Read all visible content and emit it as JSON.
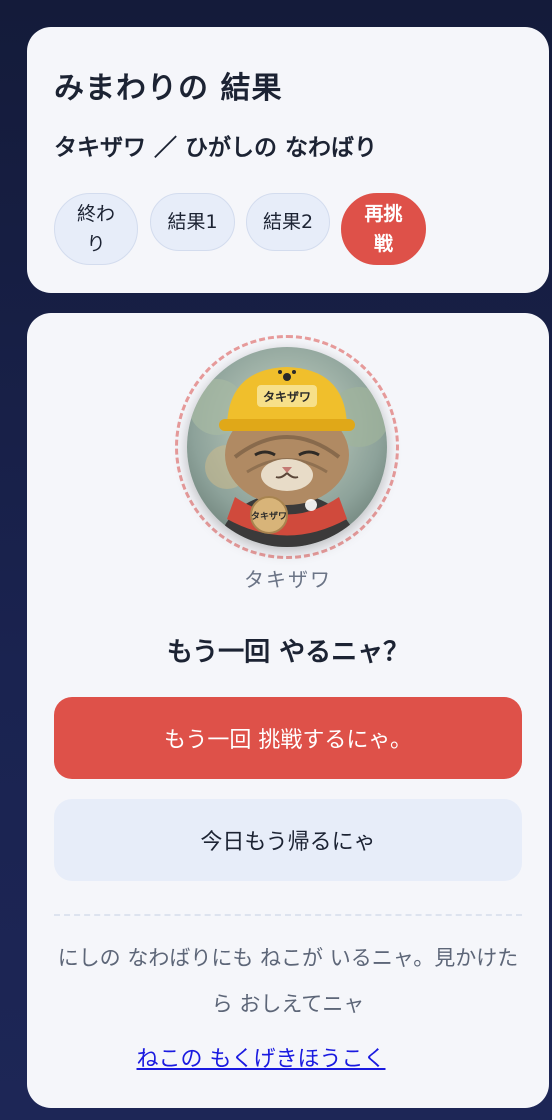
{
  "header": {
    "title": "みまわりの 結果",
    "subtitle": "タキザワ ／ ひがしの なわばり"
  },
  "tabs": [
    {
      "label": "終わり"
    },
    {
      "label": "結果1"
    },
    {
      "label": "結果2"
    },
    {
      "label": "再挑戦"
    }
  ],
  "avatar": {
    "name": "タキザワ",
    "helmet_text": "タキザワ",
    "tag_text": "タキザワ"
  },
  "main": {
    "question": "もう一回 やるニャ？",
    "retry_button": "もう一回 挑戦するにゃ。",
    "home_button": "今日もう帰るにゃ",
    "note": "にしの なわばりにも ねこが いるニャ。見かけたら おしえてニャ",
    "report_link": "ねこの もくげきほうこく"
  },
  "colors": {
    "accent_red": "#de5149",
    "pill_bg": "#e7edf9",
    "card_bg": "#f5f6fa",
    "page_bg": "#141b3a",
    "link": "#1a1ae0"
  }
}
